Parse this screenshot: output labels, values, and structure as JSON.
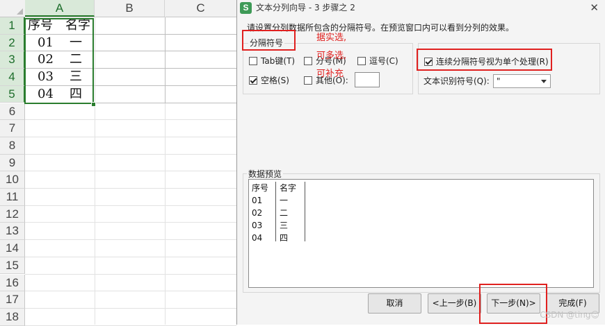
{
  "sheet": {
    "columns": [
      "A",
      "B",
      "C"
    ],
    "selected_column": "A",
    "rows": [
      "1",
      "2",
      "3",
      "4",
      "5",
      "6",
      "7",
      "8",
      "9",
      "10",
      "11",
      "12",
      "13",
      "14",
      "15",
      "16",
      "17",
      "18"
    ],
    "cells": [
      {
        "num": "序号",
        "name": "名字"
      },
      {
        "num": "01",
        "name": "一"
      },
      {
        "num": "02",
        "name": "二"
      },
      {
        "num": "03",
        "name": "三"
      },
      {
        "num": "04",
        "name": "四"
      }
    ]
  },
  "dialog": {
    "app_icon": "S",
    "title": "文本分列向导 - 3 步骤之 2",
    "close": "✕",
    "instruction": "请设置分列数据所包含的分隔符号。在预览窗口内可以看到分列的效果。",
    "separator_group": "分隔符号",
    "options": {
      "tab": {
        "label": "Tab键(T)",
        "checked": false
      },
      "semicolon": {
        "label": "分号(M)",
        "checked": false
      },
      "comma": {
        "label": "逗号(C)",
        "checked": false
      },
      "space": {
        "label": "空格(S)",
        "checked": true
      },
      "other": {
        "label": "其他(O):",
        "checked": false
      }
    },
    "consecutive": {
      "label": "连续分隔符号视为单个处理(R)",
      "checked": true
    },
    "text_qualifier_label": "文本识别符号(Q):",
    "text_qualifier_value": "\"",
    "preview_label": "数据预览",
    "preview": {
      "col1": [
        "序号",
        "01",
        "02",
        "03",
        "04"
      ],
      "col2": [
        "名字",
        "一",
        "二",
        "三",
        "四"
      ]
    },
    "buttons": {
      "cancel": "取消",
      "back": "<上一步(B)",
      "next": "下一步(N)>",
      "finish": "完成(F)"
    }
  },
  "annotations": {
    "note_lines": [
      "据实选,",
      "可多选,",
      "可补充"
    ],
    "color": "#e0201f"
  },
  "watermark": "CSDN @ting😊"
}
